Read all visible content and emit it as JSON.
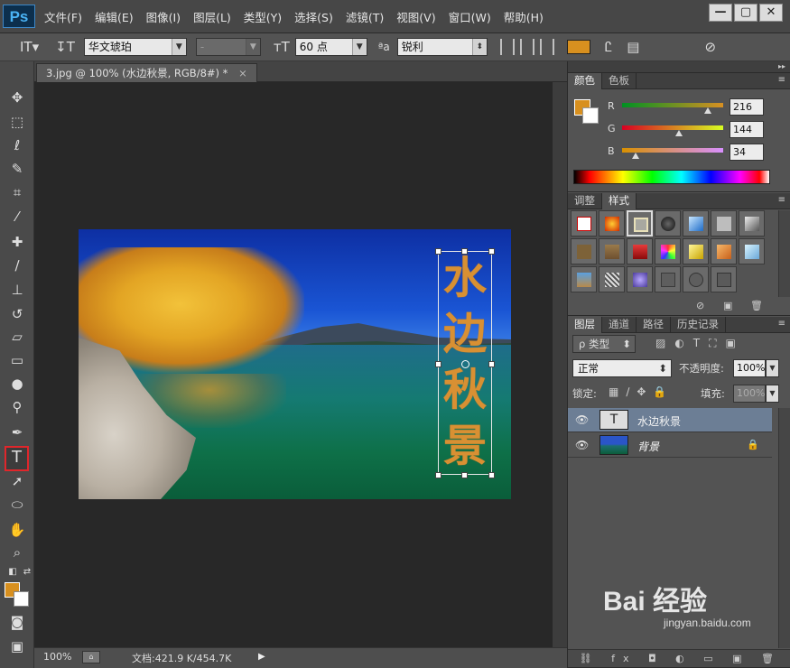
{
  "app": {
    "logo": "Ps",
    "menu": [
      "文件(F)",
      "编辑(E)",
      "图像(I)",
      "图层(L)",
      "类型(Y)",
      "选择(S)",
      "滤镜(T)",
      "视图(V)",
      "窗口(W)",
      "帮助(H)"
    ],
    "window_buttons": [
      "—",
      "▢",
      "✕"
    ]
  },
  "options_bar": {
    "font_family": "华文琥珀",
    "font_style": "-",
    "font_size": "60 点",
    "anti_alias": "锐利",
    "text_color": "#d8901f"
  },
  "document": {
    "tab_title": "3.jpg @ 100% (水边秋景, RGB/8#) *",
    "close_symbol": "×",
    "vertical_text": [
      "水",
      "边",
      "秋",
      "景"
    ],
    "text_color": "#d89033"
  },
  "status_bar": {
    "zoom": "100%",
    "doc_info": "文档:421.9 K/454.7K",
    "arrow": "▶"
  },
  "color_panel": {
    "tabs": [
      "颜色",
      "色板"
    ],
    "fg_color": "#d8901f",
    "bg_color": "#ffffff",
    "channels": [
      {
        "label": "R",
        "value": "216",
        "fraction": 0.847
      },
      {
        "label": "G",
        "value": "144",
        "fraction": 0.565
      },
      {
        "label": "B",
        "value": "34",
        "fraction": 0.133
      }
    ]
  },
  "styles_panel": {
    "tabs": [
      "调整",
      "样式"
    ]
  },
  "layers_panel": {
    "tabs": [
      "图层",
      "通道",
      "路径",
      "历史记录"
    ],
    "kind_filter": "ρ 类型",
    "blend_mode": "正常",
    "opacity_label": "不透明度:",
    "opacity_value": "100%",
    "lock_label": "锁定:",
    "fill_label": "填充:",
    "fill_value": "100%",
    "layers": [
      {
        "name": "水边秋景",
        "type": "text",
        "selected": true,
        "thumb": "T"
      },
      {
        "name": "背景",
        "type": "image",
        "selected": false,
        "locked": true
      }
    ]
  },
  "accent_colors": {
    "selected_tool_outline": "#e0262b",
    "layer_selection": "#6c7e95"
  },
  "watermark": {
    "brand": "Bai 经验",
    "url": "jingyan.baidu.com"
  }
}
